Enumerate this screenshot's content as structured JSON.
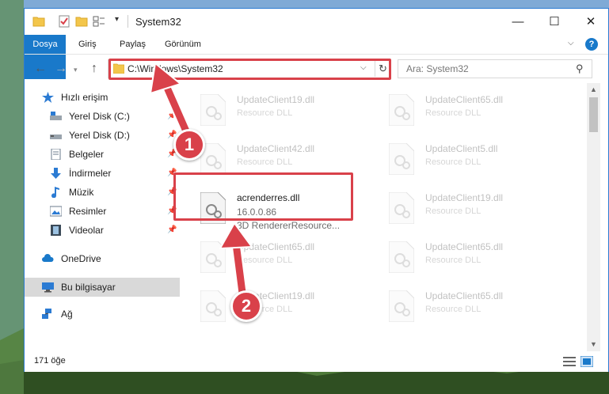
{
  "window": {
    "title": "System32"
  },
  "ribbon": {
    "tabs": [
      "Dosya",
      "Giriş",
      "Paylaş",
      "Görünüm"
    ],
    "help": "?"
  },
  "address": {
    "path": "C:\\Windows\\System32"
  },
  "search": {
    "placeholder": "Ara: System32"
  },
  "sidebar": {
    "items": [
      {
        "label": "Hızlı erişim",
        "icon": "star-icon",
        "pinned": false
      },
      {
        "label": "Yerel Disk (C:)",
        "icon": "drive-icon",
        "pinned": true
      },
      {
        "label": "Yerel Disk (D:)",
        "icon": "drive-icon",
        "pinned": true
      },
      {
        "label": "Belgeler",
        "icon": "document-icon",
        "pinned": true
      },
      {
        "label": "İndirmeler",
        "icon": "download-icon",
        "pinned": true
      },
      {
        "label": "Müzik",
        "icon": "music-icon",
        "pinned": true
      },
      {
        "label": "Resimler",
        "icon": "picture-icon",
        "pinned": true
      },
      {
        "label": "Videolar",
        "icon": "video-icon",
        "pinned": true
      },
      {
        "label": "OneDrive",
        "icon": "cloud-icon",
        "pinned": false
      },
      {
        "label": "Bu bilgisayar",
        "icon": "computer-icon",
        "pinned": false,
        "selected": true
      },
      {
        "label": "Ağ",
        "icon": "network-icon",
        "pinned": false
      }
    ]
  },
  "files": [
    {
      "name": "UpdateClient19.dll",
      "desc": "Resource DLL"
    },
    {
      "name": "UpdateClient65.dll",
      "desc": "Resource DLL"
    },
    {
      "name": "UpdateClient42.dll",
      "desc": "Resource DLL"
    },
    {
      "name": "UpdateClient5.dll",
      "desc": "Resource DLL"
    },
    {
      "name": "acrenderres.dll",
      "version": "16.0.0.86",
      "desc": "3D RendererResource..."
    },
    {
      "name": "UpdateClient19.dll",
      "desc": "Resource DLL"
    },
    {
      "name": "UpdateClient65.dll",
      "desc": "Resource DLL"
    },
    {
      "name": "UpdateClient65.dll",
      "desc": "Resource DLL"
    },
    {
      "name": "UpdateClient19.dll",
      "desc": "Resource DLL"
    },
    {
      "name": "UpdateClient65.dll",
      "desc": "Resource DLL"
    }
  ],
  "status": {
    "count": "171 öğe"
  },
  "annotations": {
    "step1": "1",
    "step2": "2",
    "color": "#d9414a"
  }
}
